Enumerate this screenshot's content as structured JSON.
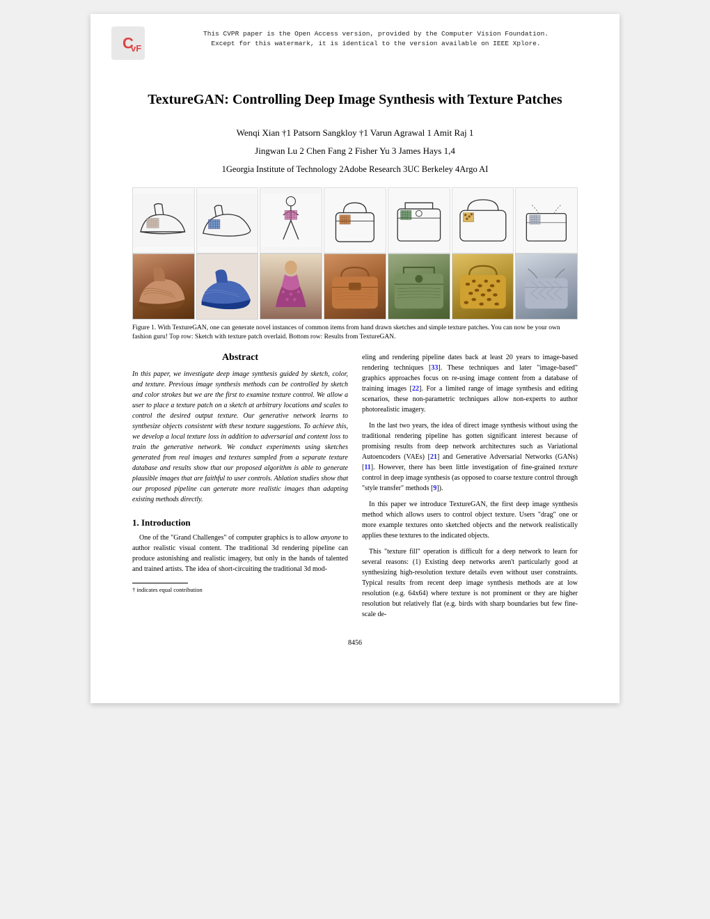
{
  "banner": {
    "text_line1": "This CVPR paper is the Open Access version, provided by the Computer Vision Foundation.",
    "text_line2": "Except for this watermark, it is identical to the version available on IEEE Xplore."
  },
  "paper": {
    "title": "TextureGAN: Controlling Deep Image Synthesis with Texture Patches",
    "authors_line1": "Wenqi Xian †1       Patsorn Sangkloy †1       Varun Agrawal 1       Amit Raj 1",
    "authors_line2": "Jingwan Lu 2    Chen Fang 2    Fisher Yu 3    James Hays 1,4",
    "affiliations": "1Georgia Institute of Technology    2Adobe Research    3UC Berkeley    4Argo AI"
  },
  "figure": {
    "caption": "Figure 1. With TextureGAN, one can generate novel instances of common items from hand drawn sketches and simple texture patches. You can now be your own fashion guru! Top row: Sketch with texture patch overlaid. Bottom row: Results from TextureGAN."
  },
  "abstract": {
    "title": "Abstract",
    "text": "In this paper, we investigate deep image synthesis guided by sketch, color, and texture. Previous image synthesis methods can be controlled by sketch and color strokes but we are the first to examine texture control. We allow a user to place a texture patch on a sketch at arbitrary locations and scales to control the desired output texture. Our generative network learns to synthesize objects consistent with these texture suggestions. To achieve this, we develop a local texture loss in addition to adversarial and content loss to train the generative network. We conduct experiments using sketches generated from real images and textures sampled from a separate texture database and results show that our proposed algorithm is able to generate plausible images that are faithful to user controls. Ablation studies show that our proposed pipeline can generate more realistic images than adapting existing methods directly."
  },
  "right_col": {
    "para1": "eling and rendering pipeline dates back at least 20 years to image-based rendering techniques [33]. These techniques and later \"image-based\" graphics approaches focus on re-using image content from a database of training images [22]. For a limited range of image synthesis and editing scenarios, these non-parametric techniques allow non-experts to author photorealistic imagery.",
    "para2": "In the last two years, the idea of direct image synthesis without using the traditional rendering pipeline has gotten significant interest because of promising results from deep network architectures such as Variational Autoencoders (VAEs) [21] and Generative Adversarial Networks (GANs) [11]. However, there has been little investigation of fine-grained texture control in deep image synthesis (as opposed to coarse texture control through \"style transfer\" methods [9]).",
    "para3": "In this paper we introduce TextureGAN, the first deep image synthesis method which allows users to control object texture. Users \"drag\" one or more example textures onto sketched objects and the network realistically applies these textures to the indicated objects.",
    "para4": "This \"texture fill\" operation is difficult for a deep network to learn for several reasons: (1) Existing deep networks aren't particularly good at synthesizing high-resolution texture details even without user constraints. Typical results from recent deep image synthesis methods are at low resolution (e.g. 64x64) where texture is not prominent or they are higher resolution but relatively flat (e.g. birds with sharp boundaries but few fine-scale de-"
  },
  "intro": {
    "title": "1. Introduction",
    "para1": "One of the \"Grand Challenges\" of computer graphics is to allow anyone to author realistic visual content. The traditional 3d rendering pipeline can produce astonishing and realistic imagery, but only in the hands of talented and trained artists. The idea of short-circuiting the traditional 3d mod-"
  },
  "footnote": {
    "text": "† indicates equal contribution"
  },
  "page_number": "8456"
}
